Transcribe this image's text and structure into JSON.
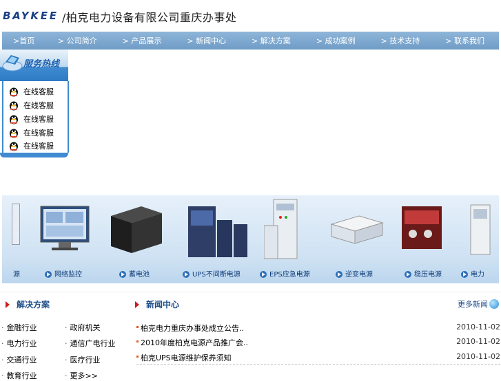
{
  "header": {
    "logo_text": "BAYKEE",
    "company_name": "/柏克电力设备有限公司重庆办事处"
  },
  "nav": {
    "items": [
      ">首页",
      "> 公司简介",
      "> 产品展示",
      "> 新闻中心",
      "> 解决方案",
      "> 成功案例",
      "> 技术支持",
      "> 联系我们"
    ]
  },
  "hotline": {
    "title": "服务热线",
    "contacts": [
      "在线客服",
      "在线客服",
      "在线客服",
      "在线客服",
      "在线客服"
    ]
  },
  "products": [
    {
      "label": "源"
    },
    {
      "label": "网络监控"
    },
    {
      "label": "蓄电池"
    },
    {
      "label": "UPS不间断电源"
    },
    {
      "label": "EPS应急电源"
    },
    {
      "label": "逆变电源"
    },
    {
      "label": "稳压电源"
    },
    {
      "label": "电力"
    }
  ],
  "solutions": {
    "title": "解决方案",
    "items": [
      "金融行业",
      "政府机关",
      "电力行业",
      "通信广电行业",
      "交通行业",
      "医疗行业",
      "教育行业",
      "更多>>"
    ]
  },
  "news": {
    "title": "新闻中心",
    "more_label": "更多新闻",
    "items": [
      {
        "title": "柏克电力重庆办事处成立公告..",
        "date": "2010-11-02"
      },
      {
        "title": "2010年度柏克电源产品推广会..",
        "date": "2010-11-02"
      },
      {
        "title": "柏克UPS电源维护保养须知",
        "date": "2010-11-02"
      }
    ]
  },
  "colors": {
    "nav_bg": "#7fa9d0",
    "accent_blue": "#3f8ad0",
    "title_blue": "#1f4f8a",
    "bullet_orange": "#e2561a",
    "triangle_red": "#c8201c"
  }
}
